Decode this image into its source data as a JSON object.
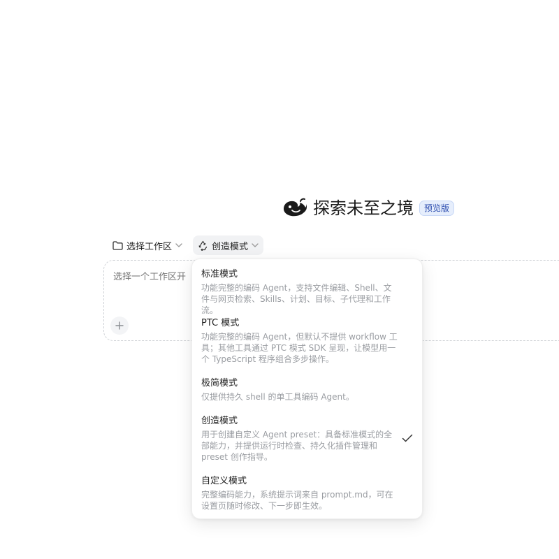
{
  "header": {
    "title": "探索未至之境",
    "badge": "预览版",
    "logo_icon": "whale-logo-icon",
    "brand_color": "#1a1a1a"
  },
  "toolbar": {
    "workspace_label": "选择工作区",
    "mode_label": "创造模式"
  },
  "composer": {
    "placeholder": "选择一个工作区开"
  },
  "modes": [
    {
      "title": "标准模式",
      "description": "功能完整的编码 Agent，支持文件编辑、Shell、文件与网页检索、Skills、计划、目标、子代理和工作流。",
      "selected": false
    },
    {
      "title": "PTC 模式",
      "description": "功能完整的编码 Agent，但默认不提供 workflow 工具；其他工具通过 PTC 模式 SDK 呈现，让模型用一个 TypeScript 程序组合多步操作。",
      "selected": false
    },
    {
      "title": "极简模式",
      "description": "仅提供持久 shell 的单工具编码 Agent。",
      "selected": false
    },
    {
      "title": "创造模式",
      "description": "用于创建自定义 Agent preset：具备标准模式的全部能力，并提供运行时检查、持久化插件管理和 preset 创作指导。",
      "selected": true
    },
    {
      "title": "自定义模式",
      "description": "完整编码能力，系统提示词来自 prompt.md，可在设置页随时修改、下一步即生效。",
      "selected": false
    }
  ]
}
